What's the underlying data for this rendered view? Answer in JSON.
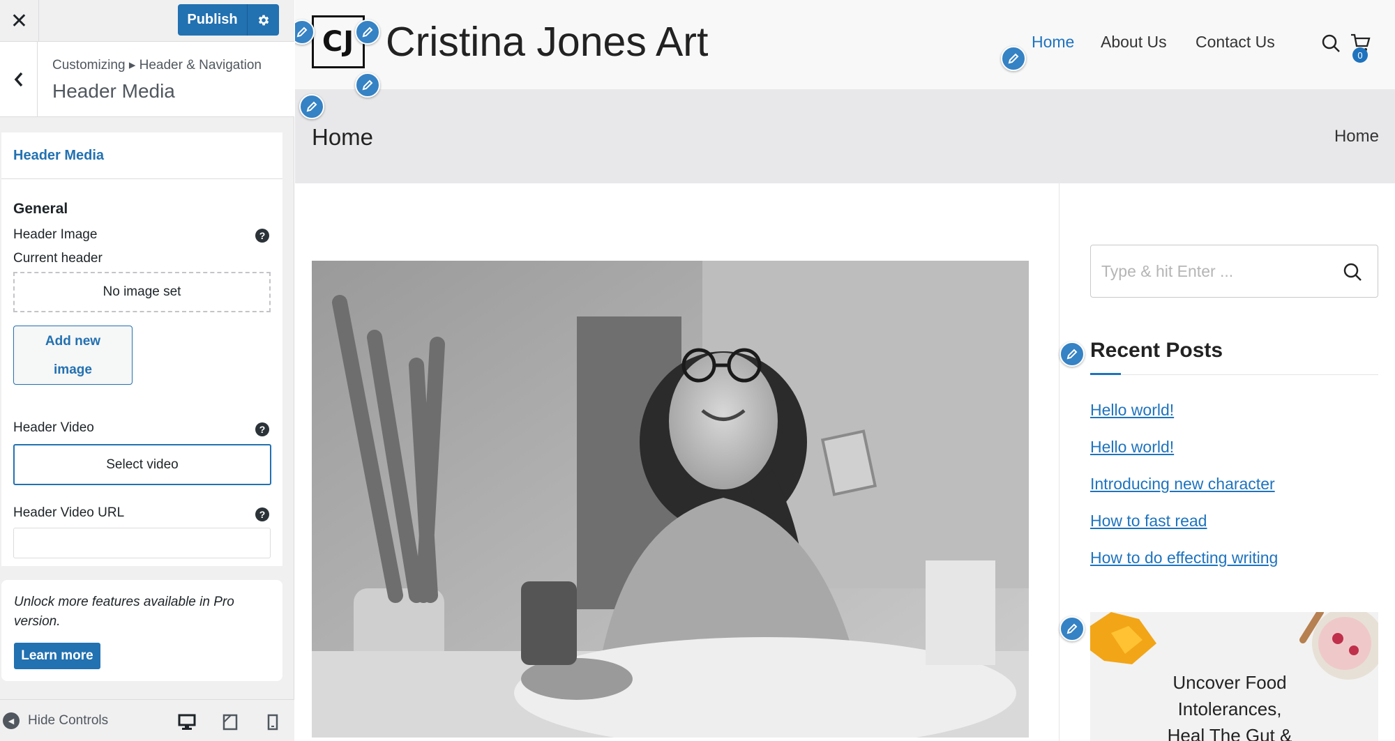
{
  "sidebar": {
    "publish_label": "Publish",
    "breadcrumb": "Customizing ▸ Header & Navigation",
    "section_title": "Header Media",
    "panel": {
      "title": "Header Media",
      "general_label": "General",
      "header_image_label": "Header Image",
      "current_header_label": "Current header",
      "no_image_text": "No image set",
      "add_image_line1": "Add new",
      "add_image_line2": "image",
      "header_video_label": "Header Video",
      "select_video_label": "Select video",
      "header_video_url_label": "Header Video URL",
      "header_video_url_value": "",
      "help_glyph": "?"
    },
    "pro": {
      "text": "Unlock more features available in Pro version.",
      "button_label": "Learn more"
    },
    "footer": {
      "hide_controls_label": "Hide Controls"
    }
  },
  "site": {
    "logo_text": "CJ",
    "title": "Cristina Jones Art",
    "nav": [
      "Home",
      "About Us",
      "Contact Us"
    ],
    "active_nav": "Home",
    "cart_count": "0",
    "page_title": "Home",
    "breadcrumb": "Home",
    "search_placeholder": "Type & hit Enter ...",
    "recent_posts_title": "Recent Posts",
    "recent_posts": [
      "Hello world!",
      "Hello world!",
      "Introducing new character",
      "How to fast read",
      "How to do effecting writing"
    ],
    "promo_text_lines": [
      "Uncover Food",
      "Intolerances,",
      "Heal The Gut &"
    ]
  },
  "colors": {
    "wp_blue": "#2271b1",
    "link_blue": "#1e73be",
    "edit_shortcut_blue": "#3582c4"
  }
}
